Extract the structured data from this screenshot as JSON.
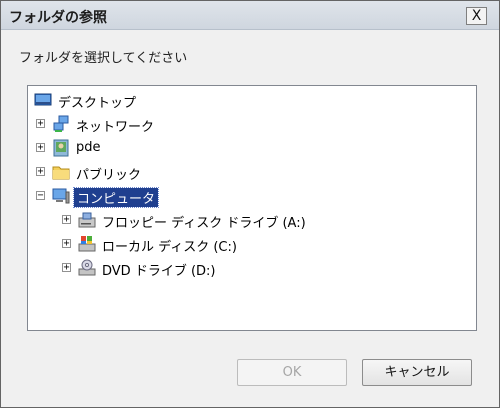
{
  "window": {
    "title": "フォルダの参照",
    "close_glyph": "X"
  },
  "prompt": "フォルダを選択してください",
  "tree": {
    "root": {
      "label": "デスクトップ",
      "icon": "desktop-icon"
    },
    "items": [
      {
        "label": "ネットワーク",
        "icon": "network-icon",
        "expander": "+"
      },
      {
        "label": "pde",
        "icon": "user-folder-icon",
        "expander": "+"
      },
      {
        "label": "パブリック",
        "icon": "folder-icon",
        "expander": "+"
      },
      {
        "label": "コンピュータ",
        "icon": "computer-icon",
        "expander": "−",
        "selected": true
      },
      {
        "label": "フロッピー ディスク ドライブ (A:)",
        "icon": "floppy-drive-icon",
        "expander": "+"
      },
      {
        "label": "ローカル ディスク (C:)",
        "icon": "local-disk-icon",
        "expander": "+"
      },
      {
        "label": "DVD ドライブ (D:)",
        "icon": "dvd-drive-icon",
        "expander": "+"
      }
    ]
  },
  "buttons": {
    "ok": "OK",
    "cancel": "キャンセル"
  },
  "colors": {
    "selection": "#1f3f8f",
    "dialog_bg": "#f0f0f0",
    "disabled_text": "#a6a6a6"
  }
}
